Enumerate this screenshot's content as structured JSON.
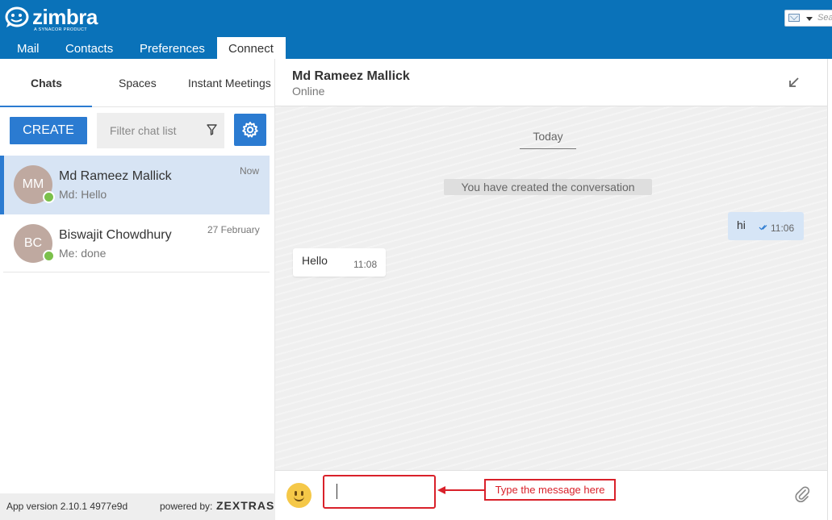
{
  "app": {
    "logo_text": "zimbra",
    "logo_subtext": "A SYNACOR PRODUCT",
    "search_placeholder": "Sea"
  },
  "app_tabs": [
    {
      "label": "Mail",
      "active": false
    },
    {
      "label": "Contacts",
      "active": false
    },
    {
      "label": "Preferences",
      "active": false
    },
    {
      "label": "Connect",
      "active": true
    }
  ],
  "sidebar": {
    "tabs": [
      {
        "label": "Chats",
        "active": true
      },
      {
        "label": "Spaces",
        "active": false
      },
      {
        "label": "Instant Meetings",
        "active": false
      }
    ],
    "create_label": "CREATE",
    "filter_placeholder": "Filter chat list",
    "chats": [
      {
        "initials": "MM",
        "name": "Md Rameez Mallick",
        "last_message": "Md: Hello",
        "time": "Now",
        "selected": true,
        "status": "online"
      },
      {
        "initials": "BC",
        "name": "Biswajit Chowdhury",
        "last_message": "Me: done",
        "time": "27 February",
        "selected": false,
        "status": "online"
      }
    ],
    "footer": {
      "version": "App version 2.10.1 4977e9d",
      "powered_by": "powered by:",
      "brand": "ZEXTRAS"
    }
  },
  "conversation": {
    "name": "Md Rameez Mallick",
    "status": "Online",
    "day_separator": "Today",
    "system_message": "You have created the conversation",
    "messages": [
      {
        "direction": "outgoing",
        "text": "hi",
        "time": "11:06",
        "read": true
      },
      {
        "direction": "incoming",
        "text": "Hello",
        "time": "11:08"
      }
    ],
    "input_value": ""
  },
  "annotation": {
    "label": "Type the message here"
  },
  "colors": {
    "header_blue": "#0a72b9",
    "accent_blue": "#2b7bd1",
    "selected_row": "#d7e4f4",
    "presence_green": "#7bc04b",
    "annotation_red": "#d9212a",
    "avatar": "#bfa9a0"
  }
}
